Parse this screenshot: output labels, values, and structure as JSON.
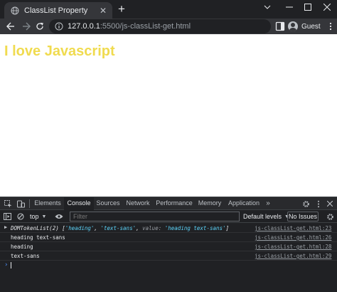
{
  "browser": {
    "tab_title": "ClassList Property",
    "url_host": "127.0.0.1",
    "url_rest": ":5500/js-classList-get.html",
    "profile_name": "Guest"
  },
  "page": {
    "heading": "I love Javascript",
    "heading_color": "#f0db4f"
  },
  "devtools": {
    "tabs": [
      "Elements",
      "Console",
      "Sources",
      "Network",
      "Performance",
      "Memory",
      "Application"
    ],
    "active_tab": "Console",
    "more_label": "»",
    "context": "top",
    "filter_placeholder": "Filter",
    "levels": "Default levels",
    "issues": "No Issues"
  },
  "console": {
    "rows": [
      {
        "prefix": "DOMTokenList(2) [",
        "items": [
          "'heading'",
          "'text-sans'"
        ],
        "value_key": "value:",
        "value": "'heading text-sans'",
        "suffix": "]",
        "source": "js-classList-get.html:23"
      },
      {
        "text": "heading text-sans",
        "source": "js-classList-get.html:26"
      },
      {
        "text": "heading",
        "source": "js-classList-get.html:28"
      },
      {
        "text": "text-sans",
        "source": "js-classList-get.html:29"
      }
    ],
    "prompt": "›"
  },
  "icons": {
    "tab": "globe-icon",
    "window": [
      "chevron-down-icon",
      "minimize-icon",
      "maximize-icon",
      "close-icon"
    ],
    "nav": [
      "back-arrow-icon",
      "forward-arrow-icon",
      "reload-icon",
      "info-icon"
    ],
    "devtools": [
      "inspect-icon",
      "device-toggle-icon",
      "settings-gear-icon",
      "kebab-menu-icon",
      "close-icon",
      "console-sidebar-icon",
      "clear-console-icon",
      "eye-icon"
    ]
  }
}
